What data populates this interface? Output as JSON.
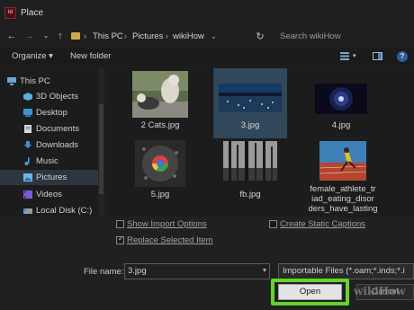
{
  "window": {
    "title": "Place",
    "app_icon": "Id"
  },
  "address": {
    "breadcrumbs": [
      "This PC",
      "Pictures",
      "wikiHow"
    ],
    "search_placeholder": "Search wikiHow"
  },
  "toolbar": {
    "organize": "Organize ▾",
    "new_folder": "New folder"
  },
  "sidebar": {
    "items": [
      {
        "label": "This PC",
        "icon": "pc-icon"
      },
      {
        "label": "3D Objects",
        "icon": "cube-icon"
      },
      {
        "label": "Desktop",
        "icon": "desktop-icon"
      },
      {
        "label": "Documents",
        "icon": "documents-icon"
      },
      {
        "label": "Downloads",
        "icon": "download-icon"
      },
      {
        "label": "Music",
        "icon": "music-icon"
      },
      {
        "label": "Pictures",
        "icon": "pictures-icon",
        "selected": true
      },
      {
        "label": "Videos",
        "icon": "videos-icon"
      },
      {
        "label": "Local Disk (C:)",
        "icon": "disk-icon"
      }
    ]
  },
  "files": [
    {
      "label_lines": [
        "2 Cats.jpg"
      ],
      "thumb": "cats-photo"
    },
    {
      "label_lines": [
        "3.jpg"
      ],
      "thumb": "city-night-photo",
      "selected": true
    },
    {
      "label_lines": [
        "4.jpg"
      ],
      "thumb": "dark-lens-photo"
    },
    {
      "label_lines": [
        "5.jpg"
      ],
      "thumb": "chrome-drop-photo"
    },
    {
      "label_lines": [
        "fb.jpg"
      ],
      "thumb": "forest-photo"
    },
    {
      "label_lines": [
        "female_athlete_tr",
        "iad_eating_disor",
        "ders_have_lasting"
      ],
      "thumb": "athlete-photo"
    }
  ],
  "options": {
    "show_import_options": {
      "label": "Show Import Options",
      "checked": false
    },
    "replace_selected_item": {
      "label": "Replace Selected Item",
      "checked": true
    },
    "create_static_captions": {
      "label": "Create Static Captions",
      "checked": false
    }
  },
  "filename": {
    "label": "File name:",
    "value": "3.jpg"
  },
  "filetype": {
    "value": "Importable Files (*.oam;*.inds;*.i"
  },
  "buttons": {
    "open": "Open",
    "cancel": "Cancel"
  },
  "watermark": "wikiHow",
  "colors": {
    "highlight": "#66d32a",
    "selection": "#31475a"
  }
}
